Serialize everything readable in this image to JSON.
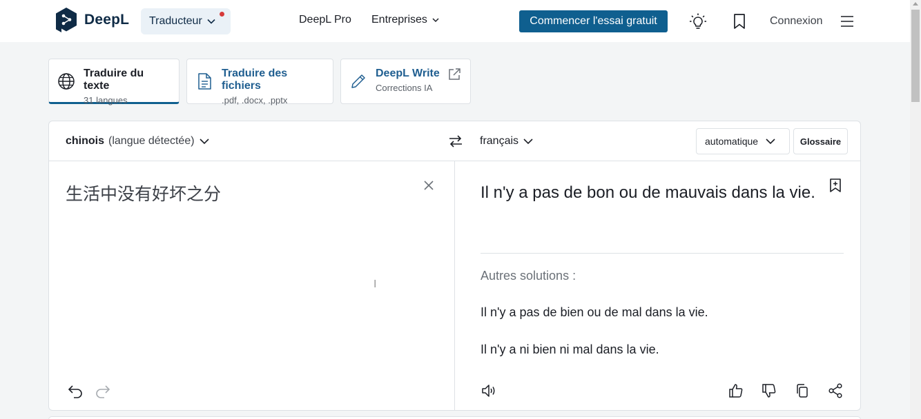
{
  "header": {
    "brand": "DeepL",
    "translator_label": "Traducteur",
    "nav": [
      "DeepL Pro",
      "Entreprises"
    ],
    "cta": "Commencer l'essai gratuit",
    "login": "Connexion"
  },
  "modes": [
    {
      "title": "Traduire du texte",
      "subtitle": "31 langues"
    },
    {
      "title": "Traduire des fichiers",
      "subtitle": ".pdf, .docx, .pptx"
    },
    {
      "title": "DeepL Write",
      "subtitle": "Corrections IA"
    }
  ],
  "translator": {
    "source_lang": "chinois",
    "source_detected": "(langue détectée)",
    "target_lang": "français",
    "formality": "automatique",
    "glossary": "Glossaire",
    "source_text": "生活中没有好坏之分",
    "target_text": "Il n'y a pas de bon ou de mauvais dans la vie.",
    "alternatives_label": "Autres solutions :",
    "alternatives": [
      "Il n'y a pas de bien ou de mal dans la vie.",
      "Il n'y a ni bien ni mal dans la vie."
    ]
  },
  "colors": {
    "brand_navy": "#0f2b46",
    "cta_blue": "#0f5f8f",
    "link_blue": "#1f5e90",
    "notification_dot": "#d63a3a"
  }
}
